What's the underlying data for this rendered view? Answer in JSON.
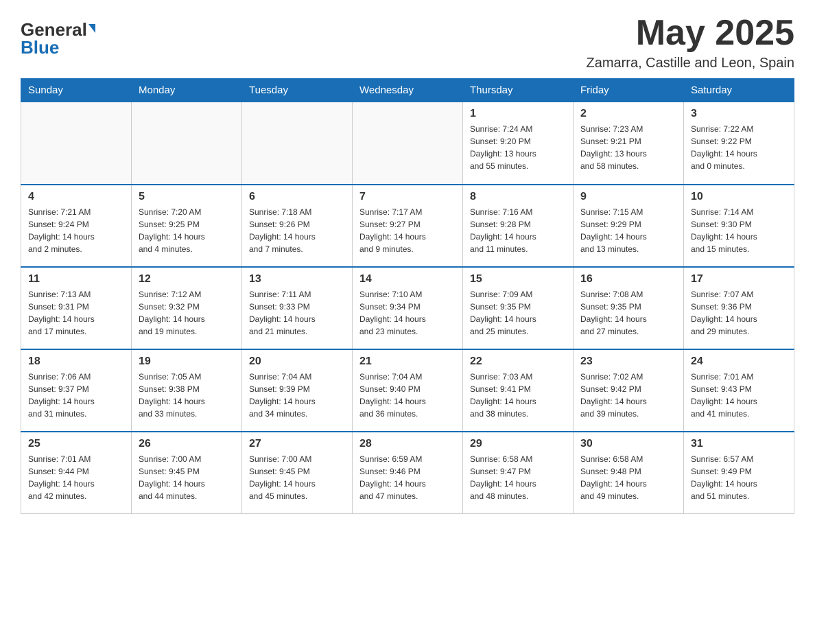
{
  "header": {
    "logo_general": "General",
    "logo_blue": "Blue",
    "month_title": "May 2025",
    "location": "Zamarra, Castille and Leon, Spain"
  },
  "days_of_week": [
    "Sunday",
    "Monday",
    "Tuesday",
    "Wednesday",
    "Thursday",
    "Friday",
    "Saturday"
  ],
  "weeks": [
    [
      {
        "day": "",
        "info": ""
      },
      {
        "day": "",
        "info": ""
      },
      {
        "day": "",
        "info": ""
      },
      {
        "day": "",
        "info": ""
      },
      {
        "day": "1",
        "info": "Sunrise: 7:24 AM\nSunset: 9:20 PM\nDaylight: 13 hours\nand 55 minutes."
      },
      {
        "day": "2",
        "info": "Sunrise: 7:23 AM\nSunset: 9:21 PM\nDaylight: 13 hours\nand 58 minutes."
      },
      {
        "day": "3",
        "info": "Sunrise: 7:22 AM\nSunset: 9:22 PM\nDaylight: 14 hours\nand 0 minutes."
      }
    ],
    [
      {
        "day": "4",
        "info": "Sunrise: 7:21 AM\nSunset: 9:24 PM\nDaylight: 14 hours\nand 2 minutes."
      },
      {
        "day": "5",
        "info": "Sunrise: 7:20 AM\nSunset: 9:25 PM\nDaylight: 14 hours\nand 4 minutes."
      },
      {
        "day": "6",
        "info": "Sunrise: 7:18 AM\nSunset: 9:26 PM\nDaylight: 14 hours\nand 7 minutes."
      },
      {
        "day": "7",
        "info": "Sunrise: 7:17 AM\nSunset: 9:27 PM\nDaylight: 14 hours\nand 9 minutes."
      },
      {
        "day": "8",
        "info": "Sunrise: 7:16 AM\nSunset: 9:28 PM\nDaylight: 14 hours\nand 11 minutes."
      },
      {
        "day": "9",
        "info": "Sunrise: 7:15 AM\nSunset: 9:29 PM\nDaylight: 14 hours\nand 13 minutes."
      },
      {
        "day": "10",
        "info": "Sunrise: 7:14 AM\nSunset: 9:30 PM\nDaylight: 14 hours\nand 15 minutes."
      }
    ],
    [
      {
        "day": "11",
        "info": "Sunrise: 7:13 AM\nSunset: 9:31 PM\nDaylight: 14 hours\nand 17 minutes."
      },
      {
        "day": "12",
        "info": "Sunrise: 7:12 AM\nSunset: 9:32 PM\nDaylight: 14 hours\nand 19 minutes."
      },
      {
        "day": "13",
        "info": "Sunrise: 7:11 AM\nSunset: 9:33 PM\nDaylight: 14 hours\nand 21 minutes."
      },
      {
        "day": "14",
        "info": "Sunrise: 7:10 AM\nSunset: 9:34 PM\nDaylight: 14 hours\nand 23 minutes."
      },
      {
        "day": "15",
        "info": "Sunrise: 7:09 AM\nSunset: 9:35 PM\nDaylight: 14 hours\nand 25 minutes."
      },
      {
        "day": "16",
        "info": "Sunrise: 7:08 AM\nSunset: 9:35 PM\nDaylight: 14 hours\nand 27 minutes."
      },
      {
        "day": "17",
        "info": "Sunrise: 7:07 AM\nSunset: 9:36 PM\nDaylight: 14 hours\nand 29 minutes."
      }
    ],
    [
      {
        "day": "18",
        "info": "Sunrise: 7:06 AM\nSunset: 9:37 PM\nDaylight: 14 hours\nand 31 minutes."
      },
      {
        "day": "19",
        "info": "Sunrise: 7:05 AM\nSunset: 9:38 PM\nDaylight: 14 hours\nand 33 minutes."
      },
      {
        "day": "20",
        "info": "Sunrise: 7:04 AM\nSunset: 9:39 PM\nDaylight: 14 hours\nand 34 minutes."
      },
      {
        "day": "21",
        "info": "Sunrise: 7:04 AM\nSunset: 9:40 PM\nDaylight: 14 hours\nand 36 minutes."
      },
      {
        "day": "22",
        "info": "Sunrise: 7:03 AM\nSunset: 9:41 PM\nDaylight: 14 hours\nand 38 minutes."
      },
      {
        "day": "23",
        "info": "Sunrise: 7:02 AM\nSunset: 9:42 PM\nDaylight: 14 hours\nand 39 minutes."
      },
      {
        "day": "24",
        "info": "Sunrise: 7:01 AM\nSunset: 9:43 PM\nDaylight: 14 hours\nand 41 minutes."
      }
    ],
    [
      {
        "day": "25",
        "info": "Sunrise: 7:01 AM\nSunset: 9:44 PM\nDaylight: 14 hours\nand 42 minutes."
      },
      {
        "day": "26",
        "info": "Sunrise: 7:00 AM\nSunset: 9:45 PM\nDaylight: 14 hours\nand 44 minutes."
      },
      {
        "day": "27",
        "info": "Sunrise: 7:00 AM\nSunset: 9:45 PM\nDaylight: 14 hours\nand 45 minutes."
      },
      {
        "day": "28",
        "info": "Sunrise: 6:59 AM\nSunset: 9:46 PM\nDaylight: 14 hours\nand 47 minutes."
      },
      {
        "day": "29",
        "info": "Sunrise: 6:58 AM\nSunset: 9:47 PM\nDaylight: 14 hours\nand 48 minutes."
      },
      {
        "day": "30",
        "info": "Sunrise: 6:58 AM\nSunset: 9:48 PM\nDaylight: 14 hours\nand 49 minutes."
      },
      {
        "day": "31",
        "info": "Sunrise: 6:57 AM\nSunset: 9:49 PM\nDaylight: 14 hours\nand 51 minutes."
      }
    ]
  ]
}
